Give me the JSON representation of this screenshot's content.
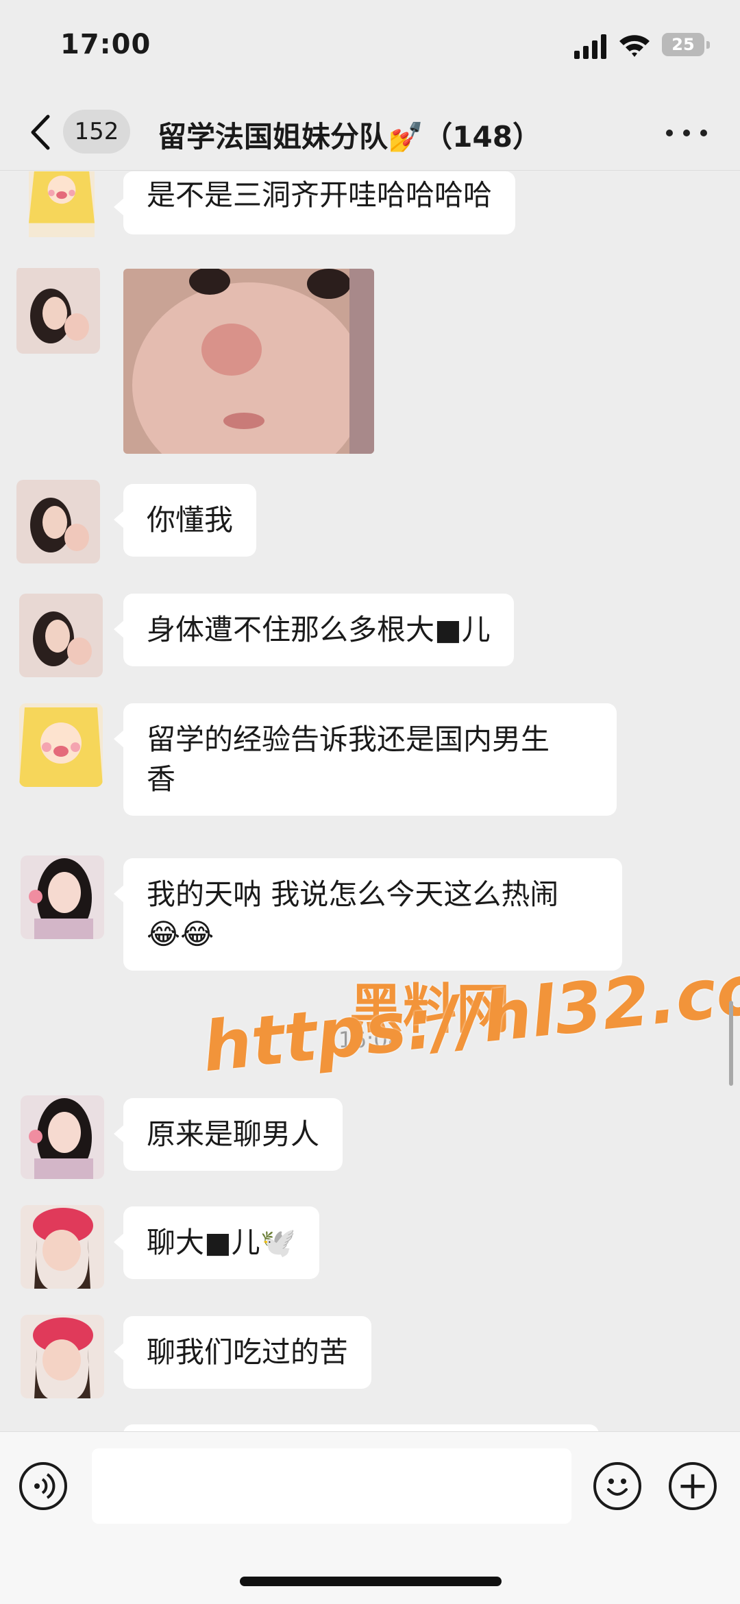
{
  "status_bar": {
    "time": "17:00",
    "battery": "25"
  },
  "nav": {
    "unread_count": "152",
    "title": "留学法国姐妹分队💅（148）"
  },
  "messages": [
    {
      "avatar": "cartoon-girl-avatar",
      "text": "是不是三洞齐开哇哈哈哈哈"
    },
    {
      "avatar": "girl-avatar",
      "image": "crying-baby-photo"
    },
    {
      "avatar": "girl-avatar",
      "text": "你懂我"
    },
    {
      "avatar": "girl-avatar",
      "text": "身体遭不住那么多根大■儿"
    },
    {
      "avatar": "cartoon-girl-avatar",
      "text": "留学的经验告诉我还是国内男生\n香"
    },
    {
      "avatar": "long-hair-girl-avatar",
      "text": "我的天呐 我说怎么今天这么热闹\n😂😂"
    },
    {
      "avatar": "long-hair-girl-avatar",
      "text": "原来是聊男人"
    },
    {
      "avatar": "red-hat-girl-avatar",
      "text": "聊大■儿🕊️"
    },
    {
      "avatar": "red-hat-girl-avatar",
      "text": "聊我们吃过的苦"
    }
  ],
  "time_separator": "16:08",
  "watermark": {
    "line1": "黑料网",
    "line2": "https://hl32.co"
  },
  "input_bar": {
    "placeholder": "",
    "plus_label": "+"
  },
  "colors": {
    "background": "#ededed",
    "bubble": "#ffffff",
    "watermark": "#f2943a"
  }
}
